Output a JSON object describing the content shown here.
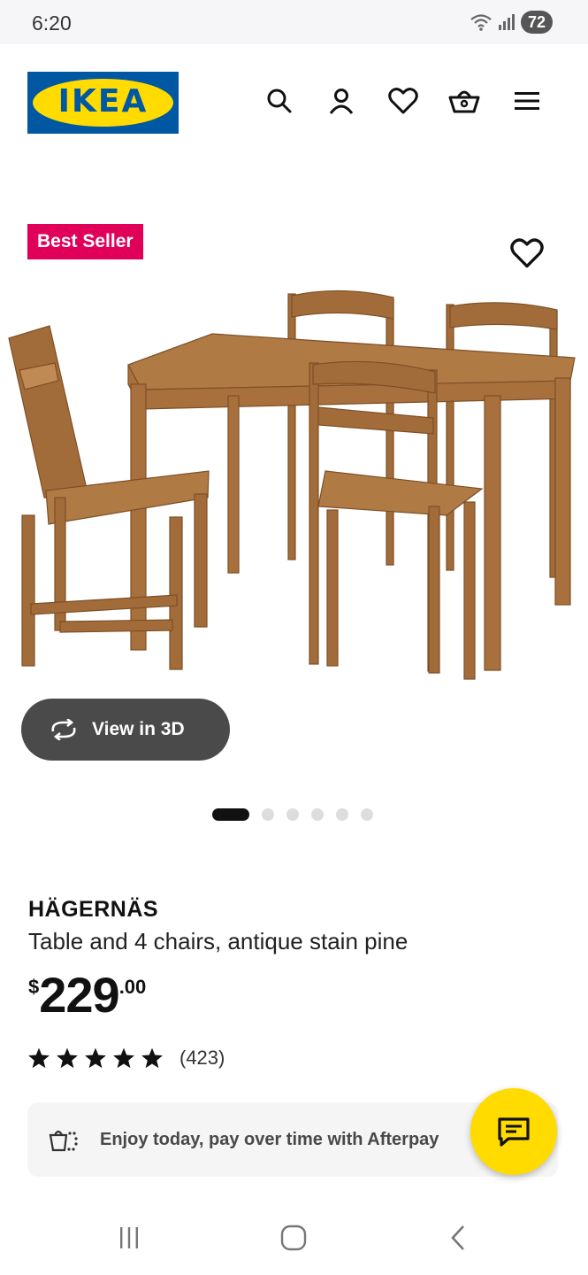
{
  "status_bar": {
    "time": "6:20",
    "battery": "72",
    "icons": [
      "wifi-icon",
      "signal-icon",
      "battery-icon"
    ]
  },
  "header": {
    "logo_text": "IKEA",
    "icons": [
      "search-icon",
      "account-icon",
      "favorites-icon",
      "basket-icon",
      "menu-icon"
    ]
  },
  "product": {
    "badge": "Best Seller",
    "name": "HÄGERNÄS",
    "description": "Table and 4 chairs, antique stain pine",
    "price": {
      "currency": "$",
      "integer": "229",
      "decimal": ".00"
    },
    "rating": {
      "stars": 5,
      "review_count": "(423)"
    },
    "view_3d_label": "View in 3D",
    "gallery": {
      "total": 6,
      "active": 0
    }
  },
  "afterpay": {
    "text": "Enjoy today, pay over time with Afterpay"
  },
  "colors": {
    "ikea_blue": "#0058a3",
    "ikea_yellow": "#ffdb00",
    "badge_pink": "#e0005a",
    "view3d_bg": "#4a4a4a",
    "wood": "#a26c3a"
  },
  "nav": {
    "icons": [
      "recent-apps-icon",
      "home-icon",
      "back-icon"
    ]
  }
}
